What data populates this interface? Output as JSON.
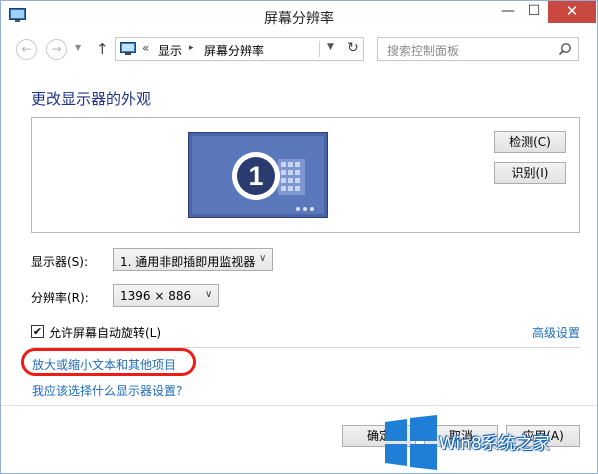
{
  "window": {
    "title": "屏幕分辨率",
    "minimize_glyph": "—",
    "maximize_glyph": "☐",
    "close_glyph": "✕"
  },
  "nav": {
    "back_glyph": "←",
    "forward_glyph": "→",
    "up_glyph": "↑",
    "breadcrumb_prefix": "«",
    "breadcrumb": [
      "显示",
      "屏幕分辨率"
    ],
    "breadcrumb_sep": "▸",
    "refresh_glyph": "↻",
    "search_placeholder": "搜索控制面板"
  },
  "main": {
    "heading": "更改显示器的外观",
    "monitor_number": "1",
    "detect_label": "检测(C)",
    "identify_label": "识别(I)",
    "display_label": "显示器(S):",
    "display_value": "1. 通用非即插即用监视器",
    "resolution_label": "分辨率(R):",
    "resolution_value": "1396 × 886",
    "auto_rotate_label": "允许屏幕自动旋转(L)",
    "auto_rotate_checked": true,
    "advanced_link": "高级设置",
    "text_size_link": "放大或缩小文本和其他项目",
    "which_settings_link": "我应该选择什么显示器设置?"
  },
  "footer": {
    "ok_label": "确定",
    "cancel_label": "取消",
    "apply_label": "应用(A)"
  },
  "watermark": {
    "text": "Win8系统之家"
  },
  "colors": {
    "link": "#1e6bbd",
    "heading": "#1e3287",
    "highlight_ring": "#ee1c16",
    "close_button": "#c9483f"
  }
}
